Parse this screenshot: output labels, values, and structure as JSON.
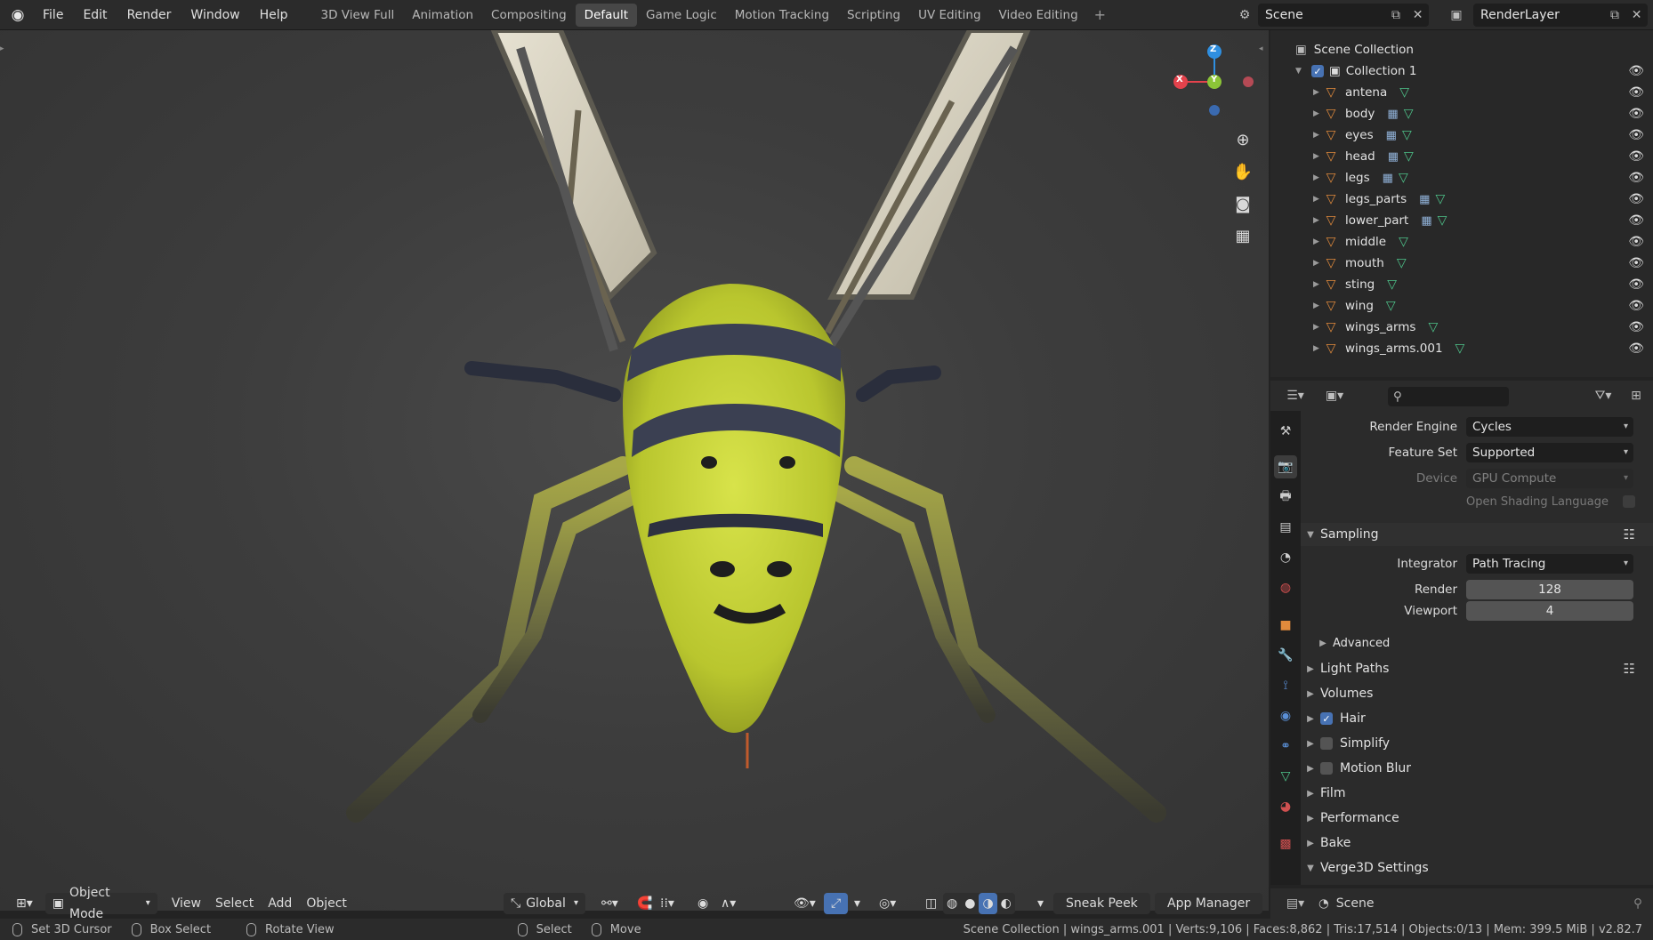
{
  "topbar": {
    "menus": [
      "File",
      "Edit",
      "Render",
      "Window",
      "Help"
    ],
    "workspaces": [
      "3D View Full",
      "Animation",
      "Compositing",
      "Default",
      "Game Logic",
      "Motion Tracking",
      "Scripting",
      "UV Editing",
      "Video Editing"
    ],
    "active_workspace": "Default",
    "scene": "Scene",
    "render_layer": "RenderLayer"
  },
  "viewport": {
    "mode": "Object Mode",
    "menus": [
      "View",
      "Select",
      "Add",
      "Object"
    ],
    "orientation": "Global",
    "buttons": {
      "sneak_peek": "Sneak Peek",
      "app_manager": "App Manager"
    },
    "gizmo": {
      "x": "X",
      "y": "Y",
      "z": "Z"
    }
  },
  "outliner": {
    "root": "Scene Collection",
    "collection": "Collection 1",
    "items": [
      {
        "name": "antena",
        "modifier": false
      },
      {
        "name": "body",
        "modifier": true
      },
      {
        "name": "eyes",
        "modifier": true
      },
      {
        "name": "head",
        "modifier": true
      },
      {
        "name": "legs",
        "modifier": true
      },
      {
        "name": "legs_parts",
        "modifier": true
      },
      {
        "name": "lower_part",
        "modifier": true
      },
      {
        "name": "middle",
        "modifier": false
      },
      {
        "name": "mouth",
        "modifier": false
      },
      {
        "name": "sting",
        "modifier": false
      },
      {
        "name": "wing",
        "modifier": false
      },
      {
        "name": "wings_arms",
        "modifier": false
      },
      {
        "name": "wings_arms.001",
        "modifier": false
      }
    ]
  },
  "properties": {
    "render_engine": {
      "label": "Render Engine",
      "value": "Cycles"
    },
    "feature_set": {
      "label": "Feature Set",
      "value": "Supported"
    },
    "device": {
      "label": "Device",
      "value": "GPU Compute"
    },
    "osl": "Open Shading Language",
    "sampling": {
      "title": "Sampling",
      "integrator_label": "Integrator",
      "integrator": "Path Tracing",
      "render_label": "Render",
      "render": "128",
      "viewport_label": "Viewport",
      "viewport": "4",
      "advanced": "Advanced"
    },
    "panels": {
      "light_paths": "Light Paths",
      "volumes": "Volumes",
      "hair": "Hair",
      "simplify": "Simplify",
      "motion_blur": "Motion Blur",
      "film": "Film",
      "performance": "Performance",
      "bake": "Bake",
      "verge3d": "Verge3D Settings"
    },
    "footer_scene": "Scene"
  },
  "statusbar": {
    "set_cursor": "Set 3D Cursor",
    "box_select": "Box Select",
    "rotate_view": "Rotate View",
    "select": "Select",
    "move": "Move",
    "info": "Scene Collection | wings_arms.001 | Verts:9,106 | Faces:8,862 | Tris:17,514 | Objects:0/13 | Mem: 399.5 MiB | v2.82.7"
  },
  "colors": {
    "accent": "#4772b3",
    "mesh": "#e08a3c",
    "data": "#4ec38a",
    "axis_x": "#e4424c",
    "axis_y": "#8bc437",
    "axis_z": "#2f8fe0"
  }
}
